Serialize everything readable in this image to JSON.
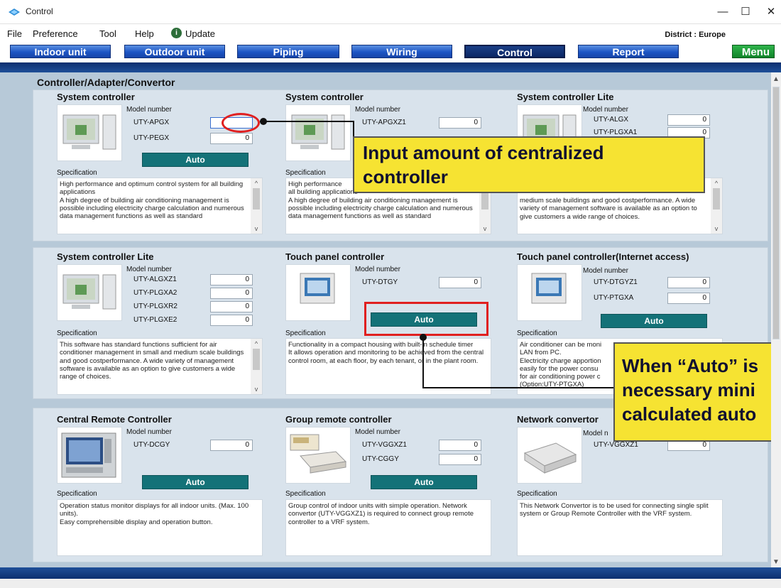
{
  "window": {
    "title": "Control",
    "controls": [
      "—",
      "☐",
      "✕"
    ]
  },
  "menu": {
    "items": [
      "File",
      "Preference",
      "Tool",
      "Help",
      "Update"
    ],
    "update_icon": "update-icon",
    "district": "District : Europe"
  },
  "tabs": [
    "Indoor unit",
    "Outdoor unit",
    "Piping",
    "Wiring",
    "Control",
    "Report",
    "Menu"
  ],
  "active_tab": "Control",
  "section_title": "Controller/Adapter/Convertor",
  "cards": [
    {
      "title": "System controller",
      "model_header": "Model number",
      "models": [
        {
          "name": "UTY-APGX",
          "value": ""
        },
        {
          "name": "UTY-PEGX",
          "value": "0"
        }
      ],
      "auto_label": "Auto",
      "spec_label": "Specification",
      "spec_text": "High performance and optimum control system for all building applications\nA high degree of building air conditioning management is possible including electricity charge calculation and numerous data management functions as well as standard"
    },
    {
      "title": "System controller",
      "model_header": "Model number",
      "models": [
        {
          "name": "UTY-APGXZ1",
          "value": "0"
        }
      ],
      "spec_label": "Specification",
      "spec_text": "High performance\nall building applications\nA high degree of building air conditioning management is possible including electricity charge calculation and numerous data management functions as well as standard"
    },
    {
      "title": "System controller Lite",
      "model_header": "Model number",
      "models": [
        {
          "name": "UTY-ALGX",
          "value": "0"
        },
        {
          "name": "UTY-PLGXA1",
          "value": "0"
        }
      ],
      "spec_text": "medium scale buildings and good costperformance. A wide variety of management software is available as an option to give customers a wide range of choices."
    },
    {
      "title": "System controller Lite",
      "model_header": "Model number",
      "models": [
        {
          "name": "UTY-ALGXZ1",
          "value": "0"
        },
        {
          "name": "UTY-PLGXA2",
          "value": "0"
        },
        {
          "name": "UTY-PLGXR2",
          "value": "0"
        },
        {
          "name": "UTY-PLGXE2",
          "value": "0"
        }
      ],
      "spec_label": "Specification",
      "spec_text": "This software has standard functions sufficient for air conditioner management in small and medium scale buildings and good costperformance. A wide variety of management software is available as an option to give customers a wide range of choices."
    },
    {
      "title": "Touch panel controller",
      "model_header": "Model number",
      "models": [
        {
          "name": "UTY-DTGY",
          "value": "0"
        }
      ],
      "auto_label": "Auto",
      "spec_label": "Specification",
      "spec_text": "Functionality in a compact housing with built-in schedule timer\nIt allows operation and monitoring to be achieved from the central control room, at each floor, by each tenant, or in the plant room."
    },
    {
      "title": "Touch panel controller(Internet access)",
      "model_header": "Model number",
      "models": [
        {
          "name": "UTY-DTGYZ1",
          "value": "0"
        },
        {
          "name": "UTY-PTGXA",
          "value": "0"
        }
      ],
      "auto_label": "Auto",
      "spec_label": "Specification",
      "spec_text": "Air conditioner can be moni\nLAN from PC.\nElectricity charge apportion\neasily for the power consu\nfor air conditioning power c\n(Option:UTY-PTGXA)"
    },
    {
      "title": "Central Remote Controller",
      "model_header": "Model number",
      "models": [
        {
          "name": "UTY-DCGY",
          "value": "0"
        }
      ],
      "auto_label": "Auto",
      "spec_label": "Specification",
      "spec_text": "Operation status monitor displays for all indoor units. (Max. 100 units).\nEasy comprehensible display and operation button."
    },
    {
      "title": "Group remote controller",
      "model_header": "Model number",
      "models": [
        {
          "name": "UTY-VGGXZ1",
          "value": "0"
        },
        {
          "name": "UTY-CGGY",
          "value": "0"
        }
      ],
      "auto_label": "Auto",
      "spec_label": "Specification",
      "spec_text": "Group control of indoor units with simple operation. Network convertor (UTY-VGGXZ1) is required to connect group remote controller to a VRF system."
    },
    {
      "title": "Network convertor",
      "model_header": "Model n",
      "models": [
        {
          "name": "UTY-VGGXZ1",
          "value": "0"
        }
      ],
      "spec_label": "Specification",
      "spec_text": "This Network Convertor is to be used for connecting single split system or Group Remote Controller with the VRF system."
    }
  ],
  "callouts": {
    "top_line1": "Input amount of centralized",
    "top_line2": "controller",
    "right_line1": "When “Auto” is",
    "right_line2": "necessary mini",
    "right_line3": "calculated auto"
  },
  "colors": {
    "tab_blue": "#1d55c4",
    "auto_teal": "#147278",
    "callout_yellow": "#f6e332",
    "highlight_red": "#e02020",
    "panel_bg": "#d9e3ec"
  }
}
